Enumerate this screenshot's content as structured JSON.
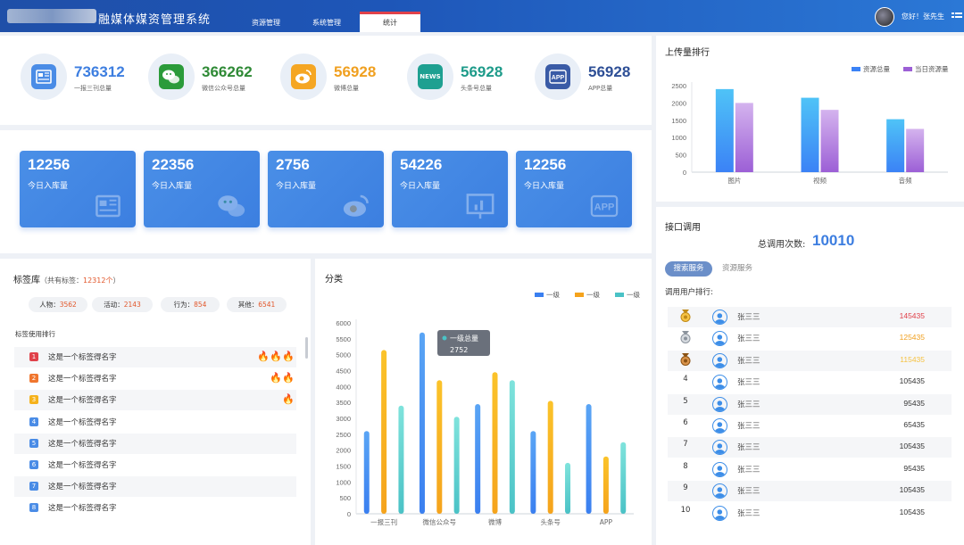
{
  "header": {
    "title": "融媒体媒资管理系统",
    "tabs": [
      {
        "label": "资源管理"
      },
      {
        "label": "系统管理"
      },
      {
        "label": "统计"
      }
    ],
    "greeting": "您好！张先生"
  },
  "stats": [
    {
      "value": "736312",
      "label": "一报三刊总量",
      "color": "#3d7ee0",
      "icon": "newspaper-icon",
      "icon_bg": "#4a8ce6"
    },
    {
      "value": "366262",
      "label": "微信公众号总量",
      "color": "#2f8a36",
      "icon": "wechat-icon",
      "icon_bg": "#2b9b3a"
    },
    {
      "value": "56928",
      "label": "微博总量",
      "color": "#f0a020",
      "icon": "weibo-icon",
      "icon_bg": "#f5a623"
    },
    {
      "value": "56928",
      "label": "头条号总量",
      "color": "#1e9b8a",
      "icon": "news-icon",
      "icon_bg": "#1ea091",
      "icon_text": "NEWS"
    },
    {
      "value": "56928",
      "label": "APP总量",
      "color": "#2e4f96",
      "icon": "app-icon",
      "icon_bg": "#3a5ba6",
      "icon_text": "APP"
    }
  ],
  "today_cards": [
    {
      "value": "12256",
      "label": "今日入库量",
      "icon": "newspaper-icon"
    },
    {
      "value": "22356",
      "label": "今日入库量",
      "icon": "wechat-icon"
    },
    {
      "value": "2756",
      "label": "今日入库量",
      "icon": "weibo-icon"
    },
    {
      "value": "54226",
      "label": "今日入库量",
      "icon": "presentation-icon"
    },
    {
      "value": "12256",
      "label": "今日入库量",
      "icon": "app-icon",
      "icon_text": "APP"
    }
  ],
  "tags": {
    "title": "标签库",
    "total_prefix": "（共有标签：",
    "total_value": "12312个",
    "total_suffix": "）",
    "pills": [
      {
        "label": "人物：",
        "value": "3562"
      },
      {
        "label": "活动：",
        "value": "2143"
      },
      {
        "label": "行为：",
        "value": "854"
      },
      {
        "label": "其他：",
        "value": "6541"
      }
    ],
    "usage_title": "标签使用排行",
    "rows": [
      {
        "rank": "1",
        "text": "这是一个标签得名字",
        "flames": 3,
        "color": "#e0414a"
      },
      {
        "rank": "2",
        "text": "这是一个标签得名字",
        "flames": 2,
        "color": "#f0762e"
      },
      {
        "rank": "3",
        "text": "这是一个标签得名字",
        "flames": 1,
        "color": "#f5b21c"
      },
      {
        "rank": "4",
        "text": "这是一个标签得名字",
        "flames": 0,
        "color": "#4a8ce6"
      },
      {
        "rank": "5",
        "text": "这是一个标签得名字",
        "flames": 0,
        "color": "#4a8ce6"
      },
      {
        "rank": "6",
        "text": "这是一个标签得名字",
        "flames": 0,
        "color": "#4a8ce6"
      },
      {
        "rank": "7",
        "text": "这是一个标签得名字",
        "flames": 0,
        "color": "#4a8ce6"
      },
      {
        "rank": "8",
        "text": "这是一个标签得名字",
        "flames": 0,
        "color": "#4a8ce6"
      }
    ]
  },
  "chart_data": [
    {
      "type": "bar",
      "title": "上传量排行",
      "categories": [
        "图片",
        "视频",
        "音频"
      ],
      "series": [
        {
          "name": "资源总量",
          "values": [
            2400,
            2150,
            1530
          ],
          "color": [
            "#4fc3f7",
            "#3b82f6"
          ]
        },
        {
          "name": "当日资源量",
          "values": [
            2000,
            1800,
            1250
          ],
          "color": [
            "#d4b3ee",
            "#9c5fd6"
          ]
        }
      ],
      "ylim": [
        0,
        2500
      ],
      "yticks": [
        0,
        500,
        1000,
        1500,
        2000,
        2500
      ],
      "legend": "top-right",
      "grid": false
    },
    {
      "type": "bar",
      "title": "分类",
      "categories": [
        "一报三刊",
        "微信公众号",
        "微博",
        "头条号",
        "APP"
      ],
      "series": [
        {
          "name": "一级",
          "values": [
            2600,
            5700,
            3450,
            2600,
            3450
          ],
          "color": [
            "#5aa5f5",
            "#3a7ff0"
          ]
        },
        {
          "name": "一级",
          "values": [
            5150,
            4200,
            4450,
            3550,
            1800
          ],
          "color": [
            "#fbc32a",
            "#f5a31c"
          ]
        },
        {
          "name": "一级",
          "values": [
            3400,
            3050,
            4200,
            1600,
            2250
          ],
          "color": [
            "#7fe3dc",
            "#4ac2c6"
          ]
        }
      ],
      "ylim": [
        0,
        6000
      ],
      "yticks": [
        0,
        500,
        1000,
        1500,
        2000,
        2500,
        3000,
        3500,
        4000,
        4500,
        5000,
        5500,
        6000
      ],
      "legend": "top-right",
      "grid": false,
      "tooltip": {
        "name": "一级总量",
        "value": "2752"
      }
    }
  ],
  "api": {
    "title": "接口调用",
    "total_label": "总调用次数:",
    "total_value": "10010",
    "tabs": [
      {
        "label": "搜索服务"
      },
      {
        "label": "资源服务"
      }
    ],
    "ranking_title": "调用用户排行:",
    "rows": [
      {
        "rank": "1",
        "name": "张三三",
        "value": "145435",
        "color": "#e0414a",
        "medal": "gold"
      },
      {
        "rank": "2",
        "name": "张三三",
        "value": "125435",
        "color": "#f0a020",
        "medal": "silver"
      },
      {
        "rank": "3",
        "name": "张三三",
        "value": "115435",
        "color": "#f5c242",
        "medal": "bronze"
      },
      {
        "rank": "4",
        "name": "张三三",
        "value": "105435",
        "color": "#333333"
      },
      {
        "rank": "5",
        "name": "张三三",
        "value": "95435",
        "color": "#333333"
      },
      {
        "rank": "6",
        "name": "张三三",
        "value": "65435",
        "color": "#333333"
      },
      {
        "rank": "7",
        "name": "张三三",
        "value": "105435",
        "color": "#333333"
      },
      {
        "rank": "8",
        "name": "张三三",
        "value": "95435",
        "color": "#333333"
      },
      {
        "rank": "9",
        "name": "张三三",
        "value": "105435",
        "color": "#333333"
      },
      {
        "rank": "10",
        "name": "张三三",
        "value": "105435",
        "color": "#333333"
      }
    ]
  },
  "colors": {
    "accent": "#3d7ee0",
    "header": "#1e56b8",
    "danger": "#e0414a"
  }
}
